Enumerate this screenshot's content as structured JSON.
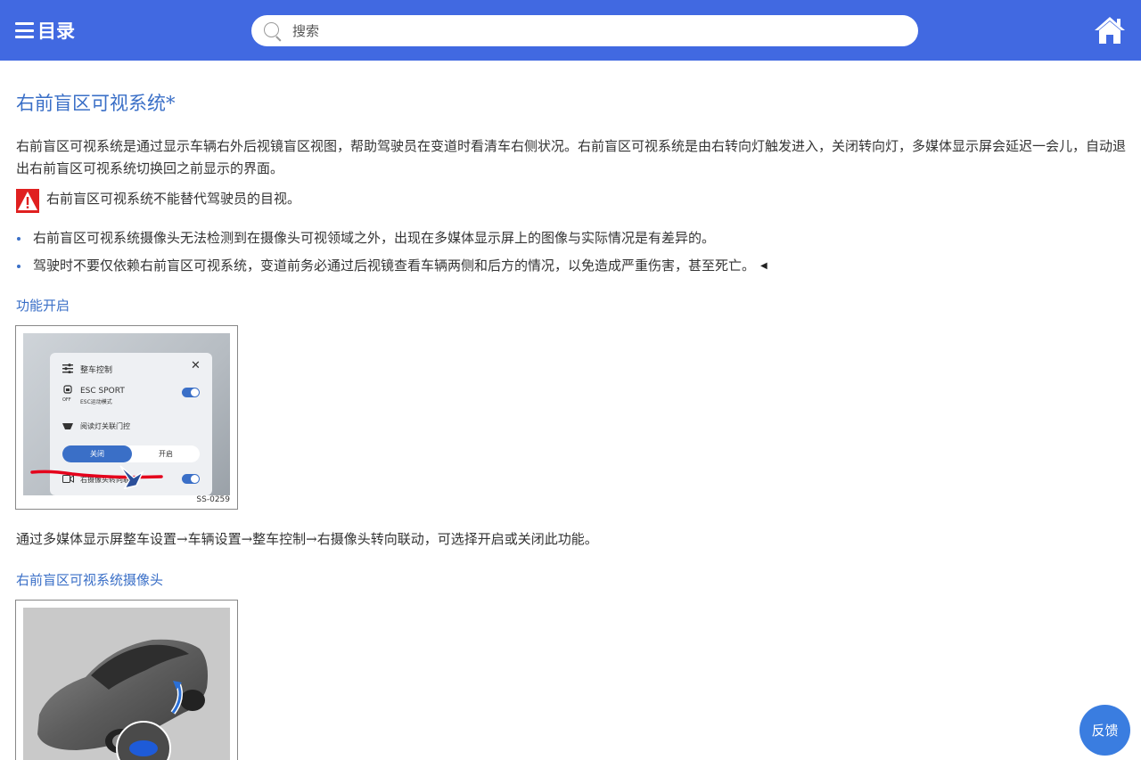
{
  "header": {
    "menu_label": "目录",
    "menu_icon": "hamburger-icon",
    "search_placeholder": "搜索",
    "home_icon": "home-icon",
    "bg_color": "#4169e1"
  },
  "article": {
    "title": "右前盲区可视系统*",
    "intro": "右前盲区可视系统是通过显示车辆右外后视镜盲区视图，帮助驾驶员在变道时看清车右侧状况。右前盲区可视系统是由右转向灯触发进入，关闭转向灯，多媒体显示屏会延迟一会儿，自动退出右前盲区可视系统切换回之前显示的界面。",
    "warning": "右前盲区可视系统不能替代驾驶员的目视。",
    "bullets": [
      "右前盲区可视系统摄像头无法检测到在摄像头可视领域之外，出现在多媒体显示屏上的图像与实际情况是有差异的。",
      "驾驶时不要仅依赖右前盲区可视系统，变道前务必通过后视镜查看车辆两侧和后方的情况，以免造成严重伤害，甚至死亡。"
    ],
    "section1_heading": "功能开启",
    "figure1": {
      "panel_title": "整车控制",
      "item1_label": "ESC SPORT",
      "item1_sub": "ESC运动模式",
      "item1_icon_text": "OFF",
      "item2_label": "阅读灯关联门控",
      "seg_off": "关闭",
      "seg_on": "开启",
      "item3_label": "右摄像头转向联动",
      "code": "SS-0259"
    },
    "section1_text": "通过多媒体显示屏整车设置→车辆设置→整车控制→右摄像头转向联动，可选择开启或关闭此功能。",
    "section2_heading": "右前盲区可视系统摄像头"
  },
  "feedback_label": "反馈",
  "colors": {
    "accent": "#3a6fc7",
    "warning_red": "#e02020",
    "feedback_bg": "#3a7de0"
  }
}
